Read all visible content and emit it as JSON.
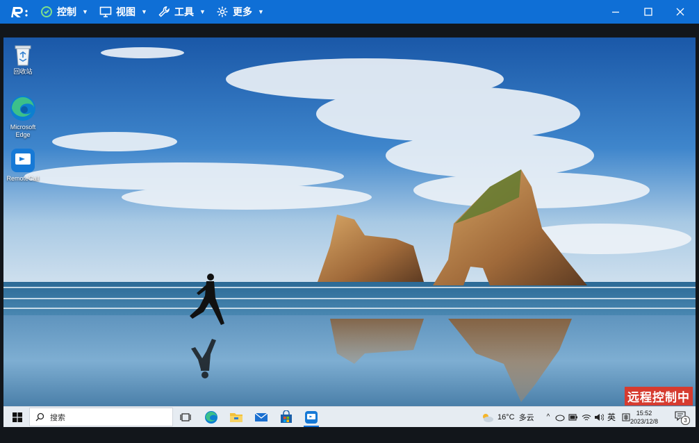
{
  "toolbar": {
    "menus": [
      {
        "label": "控制",
        "icon": "control-icon"
      },
      {
        "label": "视图",
        "icon": "monitor-icon"
      },
      {
        "label": "工具",
        "icon": "wrench-icon"
      },
      {
        "label": "更多",
        "icon": "gear-icon"
      }
    ],
    "color": "#0f6fd6"
  },
  "desktop": {
    "icons": [
      {
        "label": "回收站",
        "icon": "recycle-bin-icon"
      },
      {
        "label": "Microsoft Edge",
        "icon": "edge-icon"
      },
      {
        "label": "RemoteCall",
        "icon": "remotecall-icon"
      }
    ],
    "watermark": "远程控制中"
  },
  "taskbar": {
    "search_placeholder": "搜索",
    "apps": [
      "task-view-icon",
      "edge-icon",
      "file-explorer-icon",
      "mail-icon",
      "store-icon",
      "remotecall-icon"
    ],
    "weather": {
      "temp": "16°C",
      "desc": "多云"
    },
    "ime": "英",
    "clock": {
      "time": "15:52",
      "date": "2023/12/8"
    },
    "notification_count": "3"
  }
}
